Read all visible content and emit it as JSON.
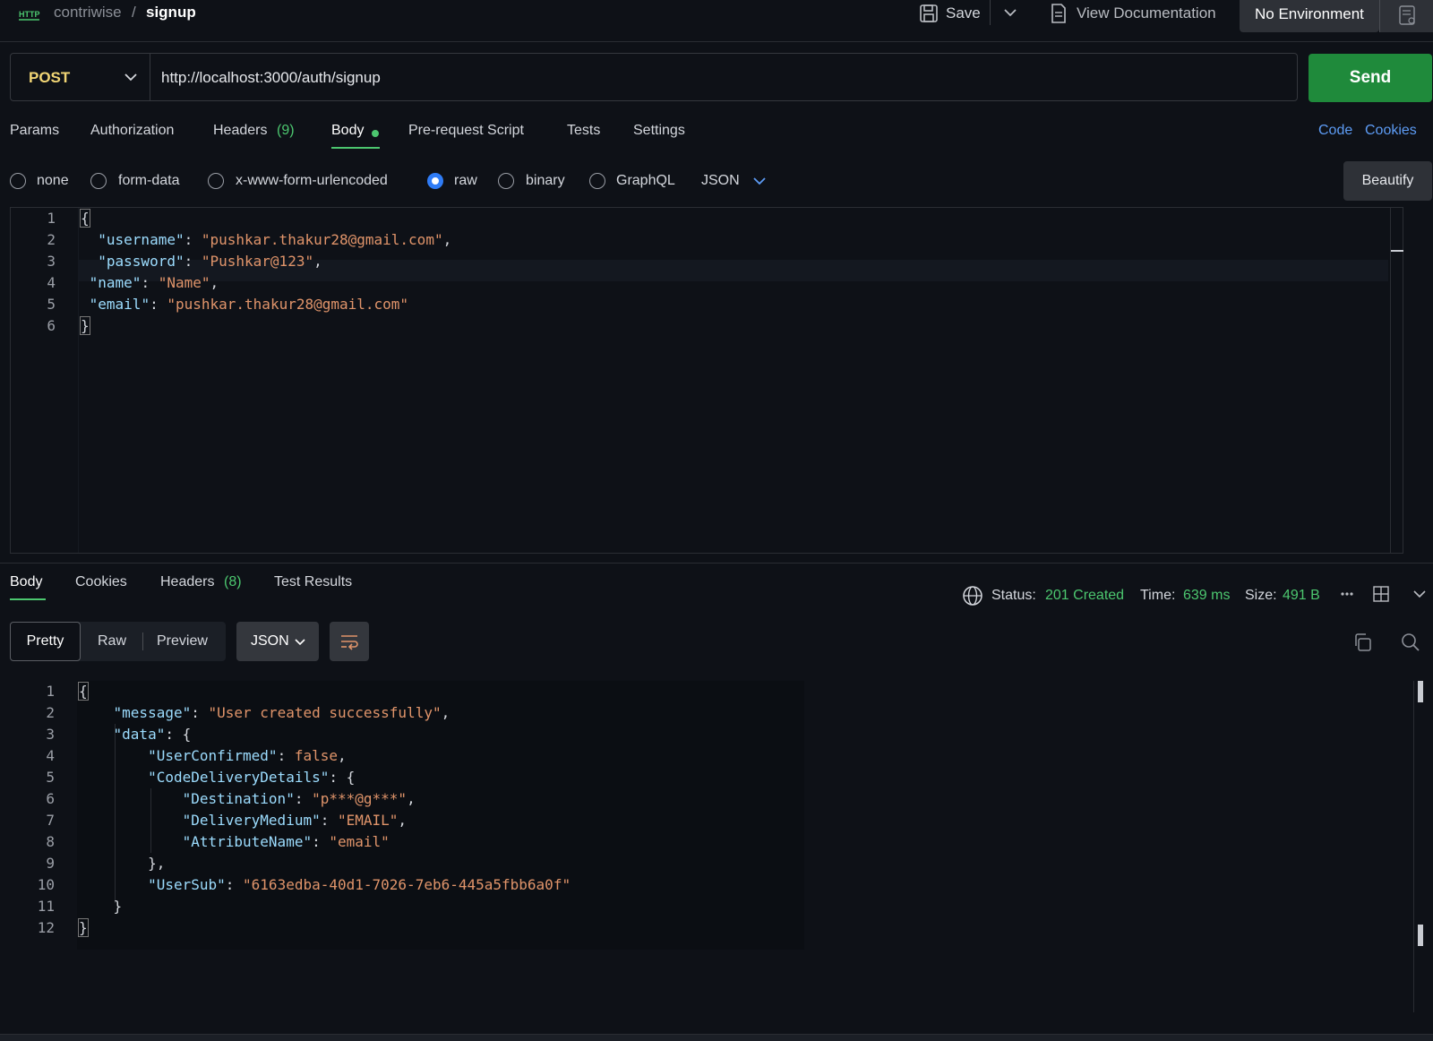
{
  "header": {
    "http_badge": "HTTP",
    "collection": "contriwise",
    "separator": "/",
    "request_name": "signup",
    "save_label": "Save",
    "view_docs_label": "View Documentation",
    "environment": "No Environment"
  },
  "request": {
    "method": "POST",
    "url": "http://localhost:3000/auth/signup",
    "send_label": "Send"
  },
  "request_tabs": {
    "params": "Params",
    "authorization": "Authorization",
    "headers": "Headers",
    "headers_count": "(9)",
    "body": "Body",
    "prerequest": "Pre-request Script",
    "tests": "Tests",
    "settings": "Settings",
    "code": "Code",
    "cookies": "Cookies"
  },
  "body_types": {
    "none": "none",
    "form_data": "form-data",
    "urlencoded": "x-www-form-urlencoded",
    "raw": "raw",
    "binary": "binary",
    "graphql": "GraphQL",
    "format": "JSON",
    "beautify": "Beautify"
  },
  "request_body": {
    "line_numbers": [
      "1",
      "2",
      "3",
      "4",
      "5",
      "6"
    ],
    "username_key": "\"username\"",
    "username_val": "\"pushkar.thakur28@gmail.com\"",
    "password_key": "\"password\"",
    "password_val": "\"Pushkar@123\"",
    "name_key": "\"name\"",
    "name_val": "\"Name\"",
    "email_key": "\"email\"",
    "email_val": "\"pushkar.thakur28@gmail.com\""
  },
  "response_tabs": {
    "body": "Body",
    "cookies": "Cookies",
    "headers": "Headers",
    "headers_count": "(8)",
    "test_results": "Test Results"
  },
  "response_meta": {
    "status_label": "Status:",
    "status_value": "201 Created",
    "time_label": "Time:",
    "time_value": "639 ms",
    "size_label": "Size:",
    "size_value": "491 B"
  },
  "response_view": {
    "pretty": "Pretty",
    "raw": "Raw",
    "preview": "Preview",
    "format": "JSON"
  },
  "response_body": {
    "line_numbers": [
      "1",
      "2",
      "3",
      "4",
      "5",
      "6",
      "7",
      "8",
      "9",
      "10",
      "11",
      "12"
    ],
    "message_key": "\"message\"",
    "message_val": "\"User created successfully\"",
    "data_key": "\"data\"",
    "userconfirmed_key": "\"UserConfirmed\"",
    "userconfirmed_val": "false",
    "cdd_key": "\"CodeDeliveryDetails\"",
    "destination_key": "\"Destination\"",
    "destination_val": "\"p***@g***\"",
    "deliverymedium_key": "\"DeliveryMedium\"",
    "deliverymedium_val": "\"EMAIL\"",
    "attributename_key": "\"AttributeName\"",
    "attributename_val": "\"email\"",
    "usersub_key": "\"UserSub\"",
    "usersub_val": "\"6163edba-40d1-7026-7eb6-445a5fbb6a0f\""
  },
  "colors": {
    "accent_green": "#1f8a3b",
    "method_yellow": "#f2d675",
    "link_blue": "#5d9cf5",
    "json_key": "#9cdcfe",
    "json_string": "#e0946a"
  }
}
